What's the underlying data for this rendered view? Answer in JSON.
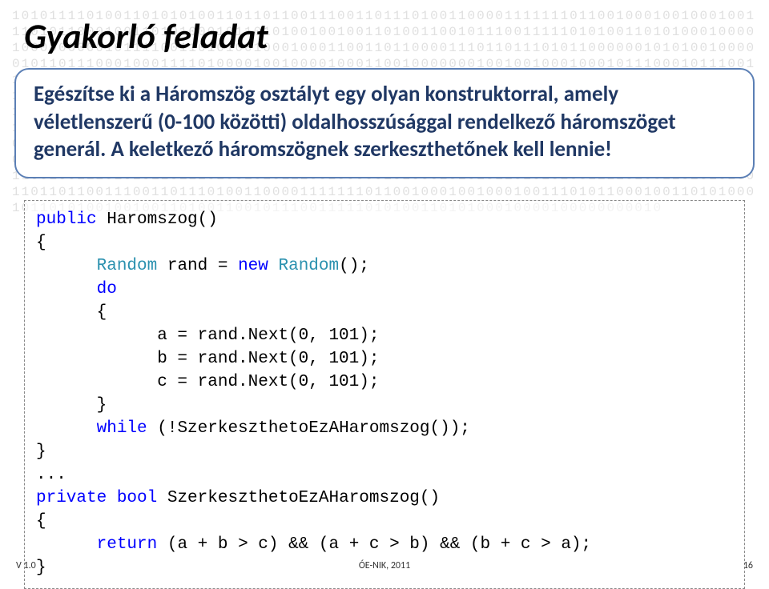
{
  "title": "Gyakorló feladat",
  "instruction": "Egészítse ki a Háromszög osztályt egy olyan konstruktorral, amely véletlenszerű (0-100 közötti) oldalhosszúsággal rendelkező háromszöget generál. A keletkező háromszögnek szerkeszthetőnek kell lennie!",
  "code": {
    "l1_kw": "public",
    "l1_rest": " Haromszog()",
    "l2": "{",
    "l3a": "      ",
    "l3_type": "Random",
    "l3_mid": " rand = ",
    "l3_new": "new",
    "l3_sp": " ",
    "l3_type2": "Random",
    "l3_end": "();",
    "l4a": "      ",
    "l4_kw": "do",
    "l5": "      {",
    "l6": "            a = rand.Next(0, 101);",
    "l7": "            b = rand.Next(0, 101);",
    "l8": "            c = rand.Next(0, 101);",
    "l9": "      }",
    "l10a": "      ",
    "l10_kw": "while",
    "l10_rest": " (!SzerkeszthetoEzAHaromszog());",
    "l11": "}",
    "l12": "...",
    "l13_kw": "private",
    "l13_sp": " ",
    "l13_bool": "bool",
    "l13_rest": " SzerkeszthetoEzAHaromszog()",
    "l14": "{",
    "l15a": "      ",
    "l15_kw": "return",
    "l15_rest": " (a + b > c) && (a + c > b) && (b + c > a);",
    "l16": "}"
  },
  "footer": {
    "left": "V 1.0",
    "center": "ÓE-NIK, 2011",
    "right": "16"
  },
  "binary": "1010111101001101010100110110110011100110111010011000011111110110010001001000100111010110001001101010001011010100100100110100110010111001111101010011010100010000100000000010111100110101001000100011001101100001110110111010110000001010100100000101101110001000111101000010010000100011001000000010010010001000101110001011100110111010110010100010001100101000101011100000000100101011011000001110010100111111111000111000101101100001100001010001001011011000111011110000110110100010001010111001001010001100001111011101001111001110001011100011001001010100110101010111100110011000010110111000101110101101011000011011101010100111101100011110011000011001001010011001011010111110001010100100101110101110010101011010101100010001011110010100111101001011101100011110101001010101001110101001101001001010101101010101010111001001110101011011101001010111001000001010001010101101010100111101001101010100110110110011100110111010011000011111110110010001001000100111010110001001101010001011010100100100110100110010111001111101010011010100010000100000000010"
}
